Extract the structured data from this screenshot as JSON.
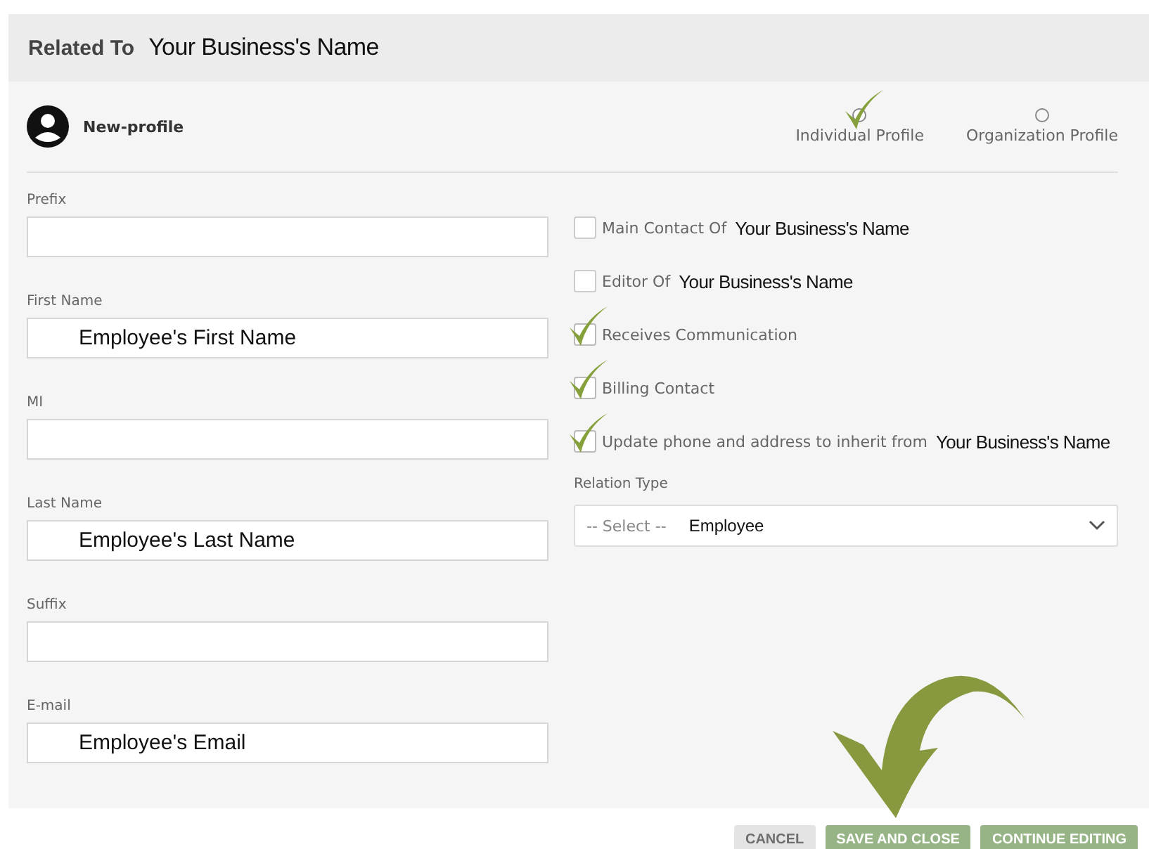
{
  "header": {
    "label": "Related To",
    "name": "Your Business's Name"
  },
  "profile": {
    "name": "New-profile"
  },
  "profile_types": [
    {
      "label": "Individual Profile",
      "selected": true
    },
    {
      "label": "Organization Profile",
      "selected": false
    }
  ],
  "fields": [
    {
      "label": "Prefix"
    },
    {
      "label": "First Name",
      "value": "Employee's First Name"
    },
    {
      "label": "MI"
    },
    {
      "label": "Last Name",
      "value": "Employee's Last Name"
    },
    {
      "label": "Suffix"
    },
    {
      "label": "E-mail",
      "value": "Employee's Email"
    }
  ],
  "options": [
    {
      "label": "Main Contact Of",
      "name": "Your Business's Name",
      "checked": false
    },
    {
      "label": "Editor Of",
      "name": "Your Business's Name",
      "checked": false
    },
    {
      "label": "Receives Communication",
      "checked": true
    },
    {
      "label": "Billing Contact",
      "checked": true
    },
    {
      "label": "Update phone and address to inherit from",
      "name": "Your Business's Name",
      "checked": true
    }
  ],
  "relation_type": {
    "label": "Relation Type",
    "placeholder": "-- Select --",
    "value": "Employee"
  },
  "buttons": [
    {
      "label": "CANCEL",
      "kind": "cancel"
    },
    {
      "label": "SAVE AND CLOSE",
      "kind": "primary"
    },
    {
      "label": "CONTINUE EDITING",
      "kind": "primary"
    }
  ]
}
